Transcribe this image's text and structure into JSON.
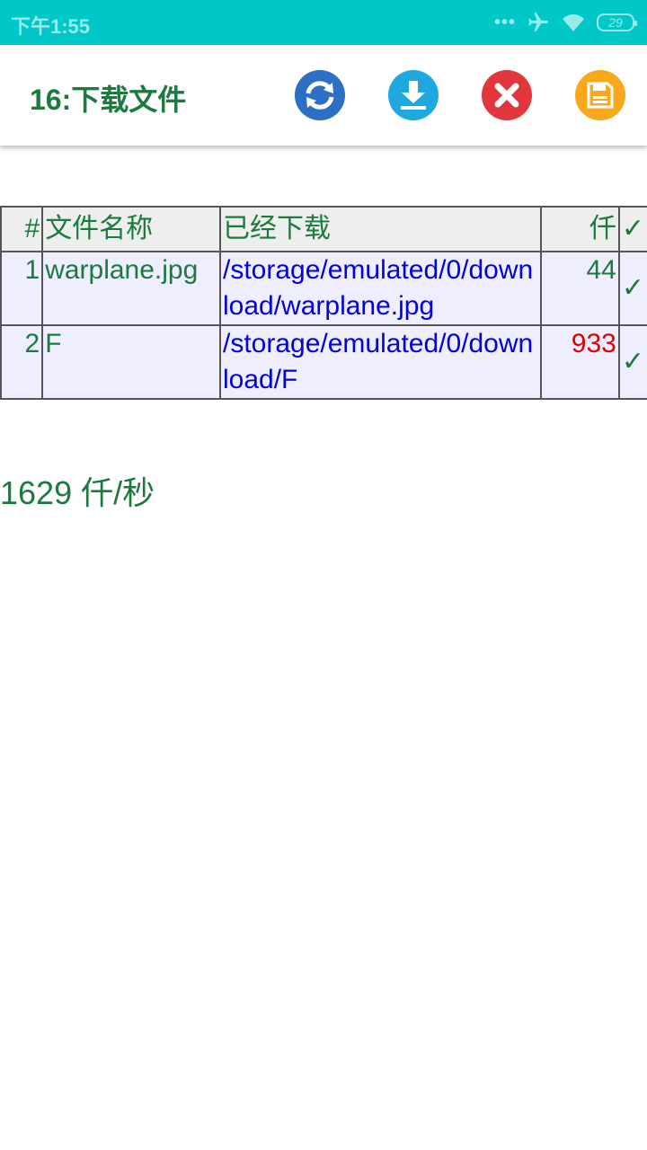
{
  "status_bar": {
    "time": "下午1:55",
    "dots": "•••",
    "battery": "29"
  },
  "toolbar": {
    "title": "16:下载文件",
    "buttons": [
      {
        "name": "refresh",
        "color": "#2d6fc4"
      },
      {
        "name": "download",
        "color": "#1fa8e0"
      },
      {
        "name": "close",
        "color": "#e0363c"
      },
      {
        "name": "save",
        "color": "#f7a81b"
      }
    ]
  },
  "table": {
    "headers": {
      "num": "#",
      "name": "文件名称",
      "downloaded": "已经下载",
      "size": "仟",
      "check": "✓"
    },
    "rows": [
      {
        "num": "1",
        "name": "warplane.jpg",
        "path": "/storage/emulated/0/download/warplane.jpg",
        "size": "44",
        "check": "✓"
      },
      {
        "num": "2",
        "name": "F",
        "path": "/storage/emulated/0/download/F",
        "size": "933",
        "check": "✓"
      }
    ]
  },
  "speed": "1629 仟/秒",
  "colors": {
    "statusbar": "#00c8c8",
    "green_text": "#1b7a3e",
    "blue_text": "#0000e0",
    "red_text": "#e00000"
  }
}
